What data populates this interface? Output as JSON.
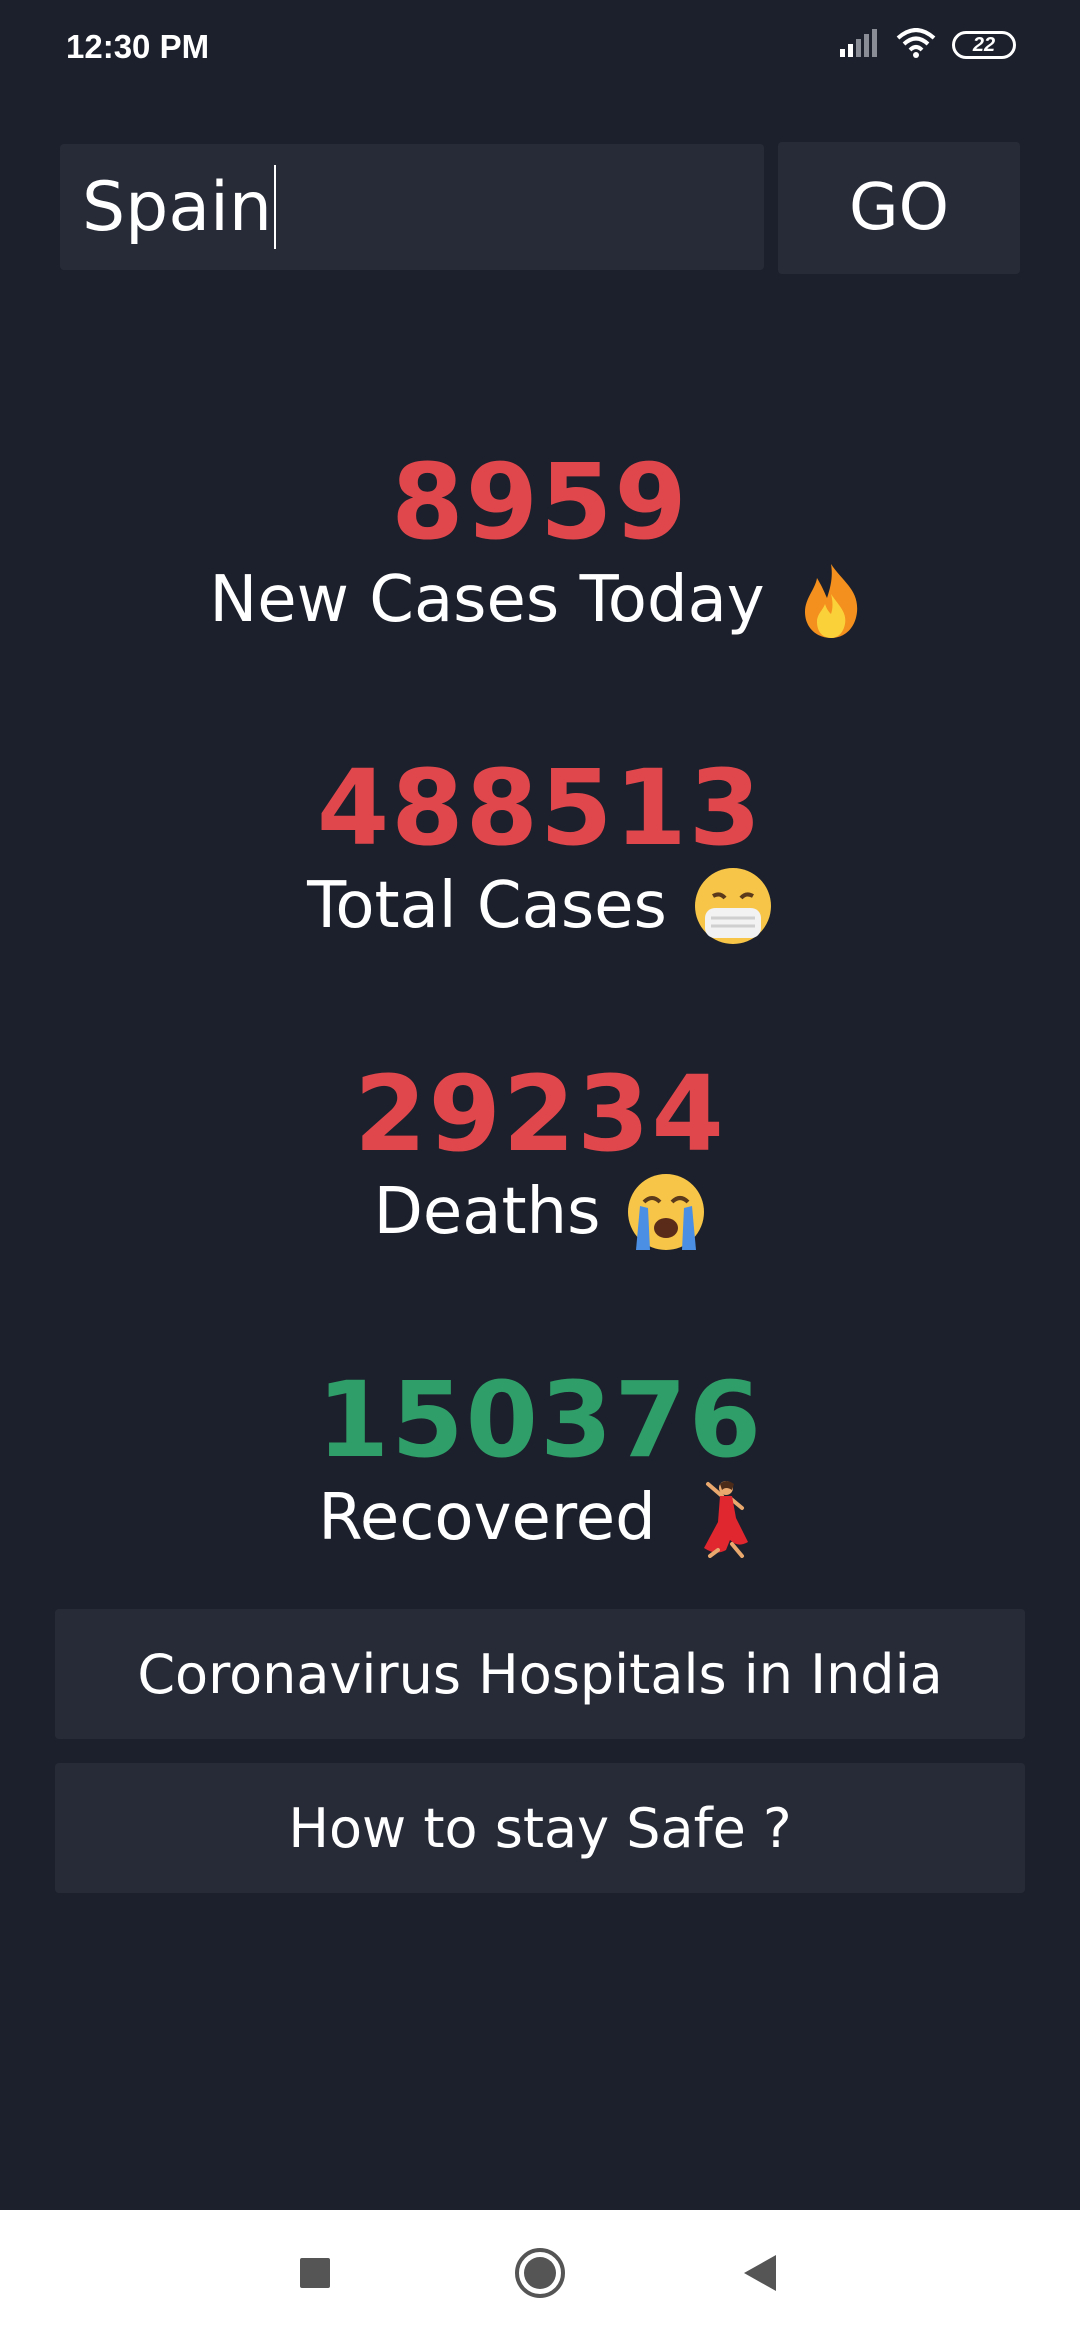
{
  "status_bar": {
    "time": "12:30 PM",
    "battery": "22",
    "icons": [
      "signal-icon",
      "wifi-icon",
      "battery-icon"
    ]
  },
  "search": {
    "value": "Spain",
    "button_label": "GO"
  },
  "stats": {
    "new_cases": {
      "value": "8959",
      "label": "New Cases Today",
      "icon": "fire-icon",
      "color": "#e0474c"
    },
    "total_cases": {
      "value": "488513",
      "label": "Total Cases",
      "icon": "face-with-mask-icon",
      "color": "#e0474c"
    },
    "deaths": {
      "value": "29234",
      "label": "Deaths",
      "icon": "crying-face-icon",
      "color": "#e0474c"
    },
    "recovered": {
      "value": "150376",
      "label": "Recovered",
      "icon": "dancer-icon",
      "color": "#2f9e68"
    }
  },
  "actions": {
    "hospitals_label": "Coronavirus Hospitals in India",
    "safety_label": "How to stay Safe ?"
  },
  "nav": {
    "icons": [
      "recents-square-icon",
      "home-circle-icon",
      "back-triangle-icon"
    ]
  },
  "colors": {
    "background": "#1c202c",
    "card": "#272b38",
    "red": "#e0474c",
    "green": "#2f9e68"
  }
}
